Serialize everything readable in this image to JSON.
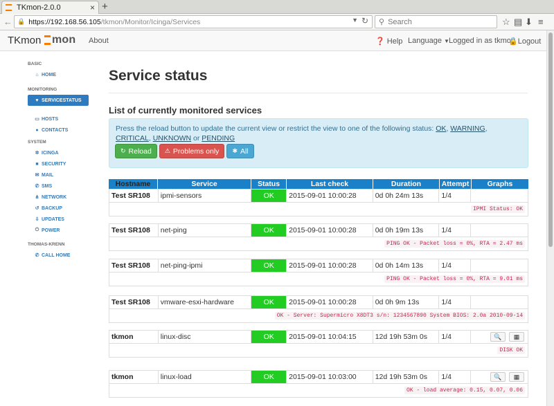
{
  "browser": {
    "tab_title": "TKmon-2.0.0",
    "tab_close": "×",
    "new_tab": "+",
    "url_host": "https://192.168.56.105",
    "url_path": "/tkmon/Monitor/Icinga/Services",
    "search_placeholder": "Search"
  },
  "app": {
    "brand": "TKmon",
    "logo_text": "mon",
    "about": "About",
    "help": "Help",
    "language": "Language",
    "logged_in": "Logged in as tkmon",
    "logout": "Logout"
  },
  "sidebar": {
    "sections": [
      {
        "label": "BASIC",
        "items": [
          {
            "label": "HOME",
            "icon": "home-icon"
          }
        ]
      },
      {
        "label": "MONITORING",
        "items": [
          {
            "label": "SERVICESTATUS",
            "icon": "heart-icon",
            "active": true
          },
          {
            "label": "HOSTS",
            "icon": "monitor-icon"
          },
          {
            "label": "CONTACTS",
            "icon": "user-icon"
          }
        ]
      },
      {
        "label": "SYSTEM",
        "items": [
          {
            "label": "ICINGA",
            "icon": "icinga-icon"
          },
          {
            "label": "SECURITY",
            "icon": "lock-icon"
          },
          {
            "label": "MAIL",
            "icon": "mail-icon"
          },
          {
            "label": "SMS",
            "icon": "phone-icon"
          },
          {
            "label": "NETWORK",
            "icon": "network-icon"
          },
          {
            "label": "BACKUP",
            "icon": "backup-icon"
          },
          {
            "label": "UPDATES",
            "icon": "download-icon"
          },
          {
            "label": "POWER",
            "icon": "power-icon"
          }
        ]
      },
      {
        "label": "THOMAS-KRENN",
        "items": [
          {
            "label": "CALL HOME",
            "icon": "phone-icon"
          }
        ]
      }
    ]
  },
  "main": {
    "title": "Service status",
    "subtitle": "List of currently monitored services",
    "info_text": "Press the reload button to update the current view or restrict the view to one of the following status:",
    "status_links": [
      "OK",
      "WARNING",
      "CRITICAL",
      "UNKNOWN",
      "PENDING"
    ],
    "link_sep": ",",
    "link_or": "or",
    "buttons": {
      "reload": "Reload",
      "problems": "Problems only",
      "all": "All"
    },
    "columns": [
      "Hostname",
      "Service",
      "Status",
      "Last check",
      "Duration",
      "Attempt",
      "Graphs"
    ],
    "services": [
      {
        "host": "Test SR108",
        "service": "ipmi-sensors",
        "status": "OK",
        "last_check": "2015-09-01 10:00:28",
        "duration": "0d 0h 24m 13s",
        "attempt": "1/4",
        "graphs": false,
        "output": "IPMI Status: OK"
      },
      {
        "host": "Test SR108",
        "service": "net-ping",
        "status": "OK",
        "last_check": "2015-09-01 10:00:28",
        "duration": "0d 0h 19m 13s",
        "attempt": "1/4",
        "graphs": false,
        "output": "PING OK - Packet loss = 0%, RTA = 2.47 ms"
      },
      {
        "host": "Test SR108",
        "service": "net-ping-ipmi",
        "status": "OK",
        "last_check": "2015-09-01 10:00:28",
        "duration": "0d 0h 14m 13s",
        "attempt": "1/4",
        "graphs": false,
        "output": "PING OK - Packet loss = 0%, RTA = 9.01 ms"
      },
      {
        "host": "Test SR108",
        "service": "vmware-esxi-hardware",
        "status": "OK",
        "last_check": "2015-09-01 10:00:28",
        "duration": "0d 0h 9m 13s",
        "attempt": "1/4",
        "graphs": false,
        "output": "OK - Server: Supermicro X8DT3 s/n: 1234567890 System BIOS: 2.0a 2010-09-14"
      },
      {
        "host": "tkmon",
        "service": "linux-disc",
        "status": "OK",
        "last_check": "2015-09-01 10:04:15",
        "duration": "12d 19h 53m 0s",
        "attempt": "1/4",
        "graphs": true,
        "output": "DISK OK"
      },
      {
        "host": "tkmon",
        "service": "linux-load",
        "status": "OK",
        "last_check": "2015-09-01 10:03:00",
        "duration": "12d 19h 53m 0s",
        "attempt": "1/4",
        "graphs": true,
        "output": "OK - load average: 0.15, 0.07, 0.06"
      }
    ]
  },
  "colors": {
    "ok": "#22cc22",
    "accent": "#1a80c8",
    "brand_orange": "#f57c00"
  }
}
